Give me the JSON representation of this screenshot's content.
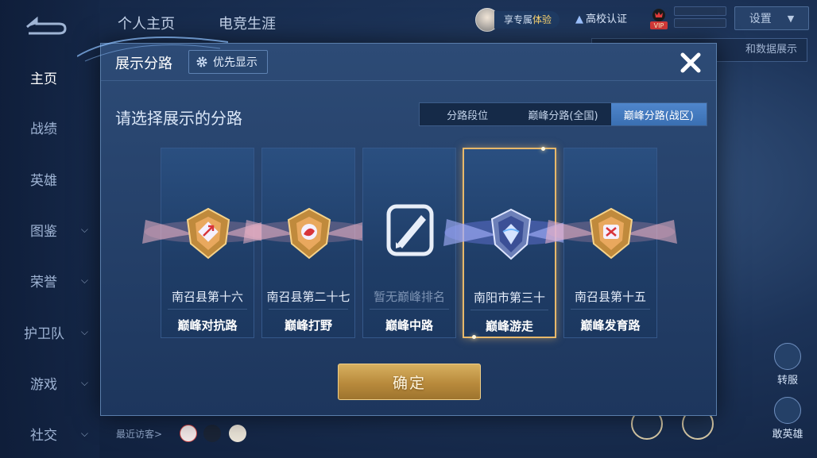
{
  "topbar": {
    "tabs": [
      "个人主页",
      "电竞生涯"
    ],
    "exclusive_prefix": "享专属",
    "exclusive_highlight": "体验",
    "campus_label": "高校认证",
    "vip_label": "VIP",
    "settings_label": "设置",
    "settings_tip": "和数据展示"
  },
  "sidebar": {
    "items": [
      {
        "label": "主页",
        "active": true,
        "chevron": false
      },
      {
        "label": "战绩",
        "active": false,
        "chevron": false
      },
      {
        "label": "英雄",
        "active": false,
        "chevron": false
      },
      {
        "label": "图鉴",
        "active": false,
        "chevron": true
      },
      {
        "label": "荣誉",
        "active": false,
        "chevron": true
      },
      {
        "label": "护卫队",
        "active": false,
        "chevron": true
      },
      {
        "label": "游戏",
        "active": false,
        "chevron": true
      },
      {
        "label": "社交",
        "active": false,
        "chevron": true
      }
    ]
  },
  "right_buttons": {
    "btn1": "转服",
    "btn2": "敢英雄"
  },
  "bottom": {
    "visitors_label": "最近访客>"
  },
  "modal": {
    "title": "展示分路",
    "priority_label": "优先显示",
    "choose_title": "请选择展示的分路",
    "segments": [
      {
        "label": "分路段位",
        "active": false
      },
      {
        "label": "巅峰分路(全国)",
        "active": false
      },
      {
        "label": "巅峰分路(战区)",
        "active": true
      }
    ],
    "cards": [
      {
        "rank": "南召县第十六",
        "lane": "巅峰对抗路",
        "emblem": "clash-lane-emblem-icon",
        "selected": false,
        "dim": false
      },
      {
        "rank": "南召县第二十七",
        "lane": "巅峰打野",
        "emblem": "jungle-emblem-icon",
        "selected": false,
        "dim": false
      },
      {
        "rank": "暂无巅峰排名",
        "lane": "巅峰中路",
        "emblem": "mid-lane-emblem-icon",
        "selected": false,
        "dim": true
      },
      {
        "rank": "南阳市第三十",
        "lane": "巅峰游走",
        "emblem": "roam-emblem-icon",
        "selected": true,
        "dim": false
      },
      {
        "rank": "南召县第十五",
        "lane": "巅峰发育路",
        "emblem": "farm-lane-emblem-icon",
        "selected": false,
        "dim": false
      }
    ],
    "confirm_label": "确定"
  },
  "colors": {
    "accent_blue": "#3a6fb2",
    "gold": "#e7b86a",
    "modal_bg": "#2d4b76"
  }
}
